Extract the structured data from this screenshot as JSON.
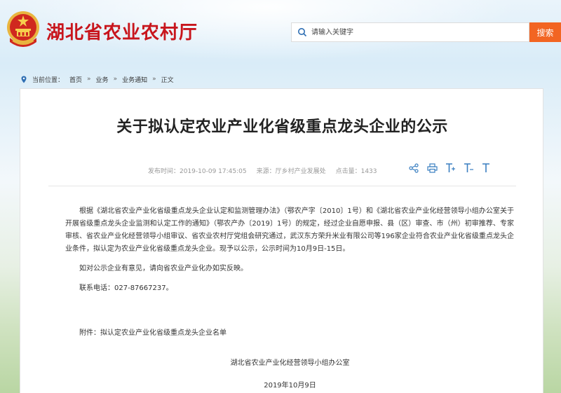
{
  "header": {
    "site_title": "湖北省农业农村厅",
    "search_placeholder": "请输入关键字",
    "search_button": "搜索"
  },
  "breadcrumb": {
    "label": "当前位置：",
    "items": [
      "首页",
      "业务",
      "业务通知",
      "正文"
    ],
    "separator": "»"
  },
  "article": {
    "title": "关于拟认定农业产业化省级重点龙头企业的公示",
    "publish_time": "发布时间：2019-10-09 17:45:05",
    "source": "来源：厅乡村产业发展处",
    "views": "点击量：1433",
    "paragraphs": [
      "根据《湖北省农业产业化省级重点龙头企业认定和监测管理办法》（鄂农产字〔2010〕1号）和《湖北省农业产业化经营领导小组办公室关于开展省级重点龙头企业监测和认定工作的通知》（鄂农产办〔2019〕1号）的规定，经过企业自愿申报、县（区）审查、市（州）初审推荐、专家审核、省农业产业化经营领导小组审议、省农业农村厅党组会研究通过，武汉东方荣升米业有限公司等196家企业符合农业产业化省级重点龙头企业条件，拟认定为农业产业化省级重点龙头企业。现予以公示，公示时间为10月9日-15日。",
      "如对公示企业有意见，请向省农业产业化办如实反映。"
    ],
    "phone": "联系电话：027-87667237。",
    "attachment": "附件：拟认定农业产业化省级重点龙头企业名单",
    "signer": "湖北省农业产业化经营领导小组办公室",
    "sign_date": "2019年10月9日"
  },
  "colors": {
    "brand_red": "#c8161d",
    "search_orange": "#f26522",
    "tool_blue": "#3a7fc1"
  },
  "icons": [
    "national-emblem-icon",
    "search-icon",
    "location-pin-icon",
    "share-icon",
    "print-icon",
    "font-large-icon",
    "font-medium-icon",
    "font-small-icon"
  ]
}
